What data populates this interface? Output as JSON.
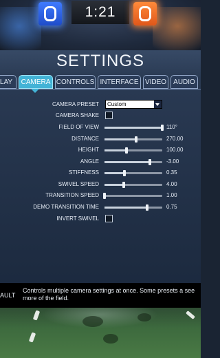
{
  "hud": {
    "blue_score": "0",
    "orange_score": "0",
    "clock": "1:21"
  },
  "settings": {
    "title": "SETTINGS",
    "tabs": [
      {
        "label": "LAY",
        "active": false
      },
      {
        "label": "CAMERA",
        "active": true
      },
      {
        "label": "CONTROLS",
        "active": false
      },
      {
        "label": "INTERFACE",
        "active": false
      },
      {
        "label": "VIDEO",
        "active": false
      },
      {
        "label": "AUDIO",
        "active": false
      }
    ],
    "rows": [
      {
        "label": "CAMERA PRESET",
        "type": "dropdown",
        "value": "Custom"
      },
      {
        "label": "CAMERA SHAKE",
        "type": "checkbox",
        "checked": false
      },
      {
        "label": "FIELD OF VIEW",
        "type": "slider",
        "value": "110°",
        "fraction": 1.0
      },
      {
        "label": "DISTANCE",
        "type": "slider",
        "value": "270.00",
        "fraction": 0.55
      },
      {
        "label": "HEIGHT",
        "type": "slider",
        "value": "100.00",
        "fraction": 0.38
      },
      {
        "label": "ANGLE",
        "type": "slider",
        "value": "-3.00",
        "fraction": 0.78
      },
      {
        "label": "STIFFNESS",
        "type": "slider",
        "value": "0.35",
        "fraction": 0.35
      },
      {
        "label": "SWIVEL SPEED",
        "type": "slider",
        "value": "4.00",
        "fraction": 0.33
      },
      {
        "label": "TRANSITION SPEED",
        "type": "slider",
        "value": "1.00",
        "fraction": 0.0
      },
      {
        "label": "DEMO TRANSITION TIME",
        "type": "slider",
        "value": "0.75",
        "fraction": 0.74
      },
      {
        "label": "INVERT SWIVEL",
        "type": "checkbox",
        "checked": false
      }
    ]
  },
  "description": {
    "default_label": "AULT",
    "text": "Controls multiple camera settings at once. Some presets a see more of the field."
  },
  "colors": {
    "accent_tab": "#43b3d6",
    "blue_team": "#3f7bff",
    "orange_team": "#ff8a3a"
  }
}
